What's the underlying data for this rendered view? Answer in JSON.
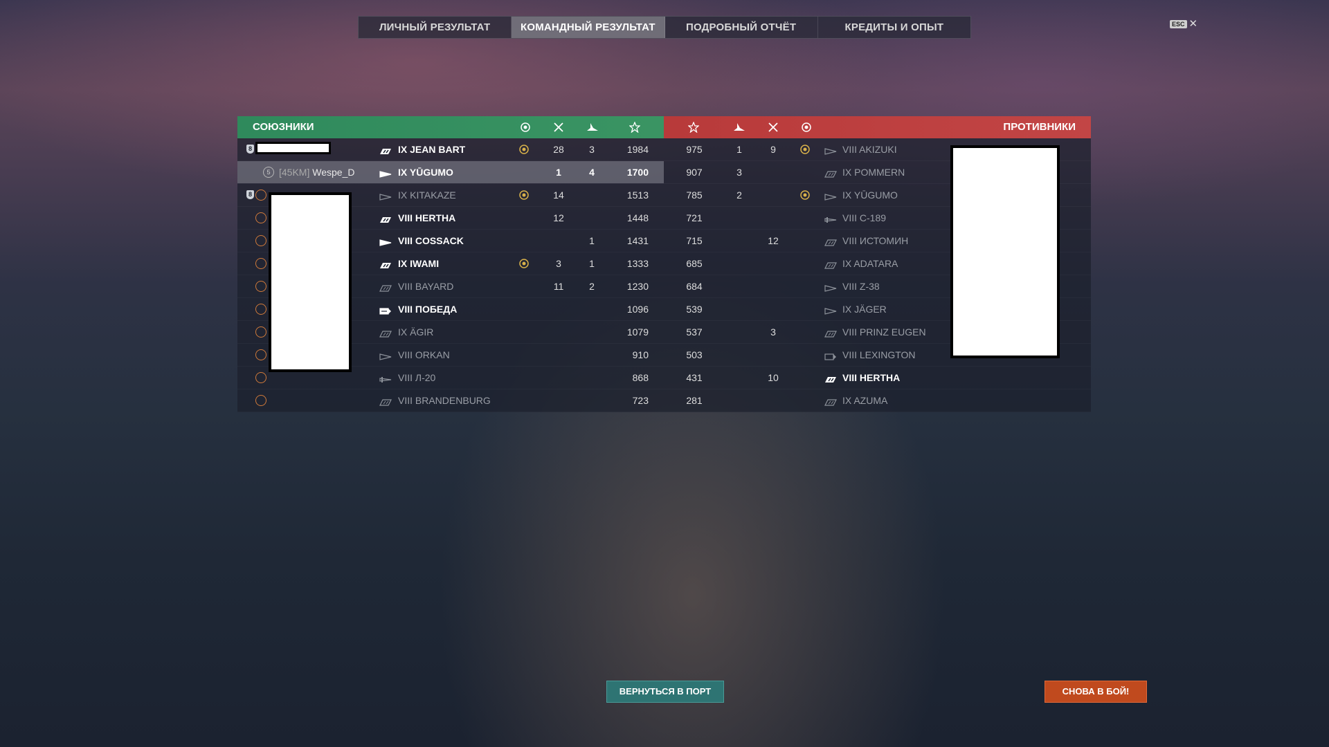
{
  "tabs": [
    {
      "label": "ЛИЧНЫЙ РЕЗУЛЬТАТ",
      "active": false
    },
    {
      "label": "КОМАНДНЫЙ РЕЗУЛЬТАТ",
      "active": true
    },
    {
      "label": "ПОДРОБНЫЙ ОТЧЁТ",
      "active": false
    },
    {
      "label": "КРЕДИТЫ И ОПЫТ",
      "active": false
    }
  ],
  "esc": {
    "key": "ESC",
    "close": "✕"
  },
  "allies": {
    "title": "СОЮЗНИКИ",
    "color": "#349060",
    "rows": [
      {
        "ship": "IX JEAN BART",
        "flag": "tree",
        "style": "bright",
        "medal": true,
        "kills": "28",
        "planes": "3",
        "score": "1984"
      },
      {
        "ship": "IX YŪGUMO",
        "flag": "dd",
        "style": "bright",
        "medal": false,
        "kills": "1",
        "planes": "4",
        "score": "1700",
        "player_clan": "[45KM]",
        "player_name": "Wespe_D",
        "player_level": "5",
        "highlight": true
      },
      {
        "ship": "IX KITAKAZE",
        "flag": "dd",
        "style": "dim",
        "medal": true,
        "kills": "14",
        "planes": "",
        "score": "1513"
      },
      {
        "ship": "VIII HERTHA",
        "flag": "tree",
        "style": "bright",
        "medal": false,
        "kills": "12",
        "planes": "",
        "score": "1448"
      },
      {
        "ship": "VIII COSSACK",
        "flag": "dd",
        "style": "bright",
        "medal": false,
        "kills": "",
        "planes": "1",
        "score": "1431"
      },
      {
        "ship": "IX IWAMI",
        "flag": "tree",
        "style": "bright",
        "medal": true,
        "kills": "3",
        "planes": "1",
        "score": "1333"
      },
      {
        "ship": "VIII BAYARD",
        "flag": "bb",
        "style": "dim",
        "medal": false,
        "kills": "11",
        "planes": "2",
        "score": "1230"
      },
      {
        "ship": "VIII ПОБЕДА",
        "flag": "cv",
        "style": "bright",
        "medal": false,
        "kills": "",
        "planes": "",
        "score": "1096"
      },
      {
        "ship": "IX ÄGIR",
        "flag": "bb",
        "style": "dim",
        "medal": false,
        "kills": "",
        "planes": "",
        "score": "1079"
      },
      {
        "ship": "VIII ORKAN",
        "flag": "dd",
        "style": "dim",
        "medal": false,
        "kills": "",
        "planes": "",
        "score": "910"
      },
      {
        "ship": "VIII Л-20",
        "flag": "sub",
        "style": "dim",
        "medal": false,
        "kills": "",
        "planes": "",
        "score": "868"
      },
      {
        "ship": "VIII BRANDENBURG",
        "flag": "bb",
        "style": "dim",
        "medal": false,
        "kills": "",
        "planes": "",
        "score": "723"
      }
    ]
  },
  "enemies": {
    "title": "ПРОТИВНИКИ",
    "color": "#c04040",
    "rows": [
      {
        "ship": "VIII AKIZUKI",
        "flag": "dd",
        "style": "dim",
        "medal": true,
        "kills": "9",
        "planes": "1",
        "score": "975"
      },
      {
        "ship": "IX POMMERN",
        "flag": "bb",
        "style": "dim",
        "medal": false,
        "kills": "",
        "planes": "3",
        "score": "907"
      },
      {
        "ship": "IX YŪGUMO",
        "flag": "dd",
        "style": "dim",
        "medal": true,
        "kills": "",
        "planes": "2",
        "score": "785"
      },
      {
        "ship": "VIII C-189",
        "flag": "sub",
        "style": "dim",
        "medal": false,
        "kills": "",
        "planes": "",
        "score": "721"
      },
      {
        "ship": "VIII ИСТОМИН",
        "flag": "bb",
        "style": "dim",
        "medal": false,
        "kills": "12",
        "planes": "",
        "score": "715"
      },
      {
        "ship": "IX ADATARA",
        "flag": "bb",
        "style": "dim",
        "medal": false,
        "kills": "",
        "planes": "",
        "score": "685"
      },
      {
        "ship": "VIII Z-38",
        "flag": "dd",
        "style": "dim",
        "medal": false,
        "kills": "",
        "planes": "",
        "score": "684"
      },
      {
        "ship": "IX JÄGER",
        "flag": "dd",
        "style": "dim",
        "medal": false,
        "kills": "",
        "planes": "",
        "score": "539"
      },
      {
        "ship": "VIII PRINZ EUGEN",
        "flag": "bb",
        "style": "dim",
        "medal": false,
        "kills": "3",
        "planes": "",
        "score": "537"
      },
      {
        "ship": "VIII LEXINGTON",
        "flag": "cv",
        "style": "dim",
        "medal": false,
        "kills": "",
        "planes": "",
        "score": "503"
      },
      {
        "ship": "VIII HERTHA",
        "flag": "tree",
        "style": "bright",
        "medal": false,
        "kills": "10",
        "planes": "",
        "score": "431"
      },
      {
        "ship": "IX AZUMA",
        "flag": "bb",
        "style": "dim",
        "medal": false,
        "kills": "",
        "planes": "",
        "score": "281"
      }
    ]
  },
  "buttons": {
    "port": "ВЕРНУТЬСЯ В ПОРТ",
    "battle": "СНОВА В БОЙ!"
  }
}
